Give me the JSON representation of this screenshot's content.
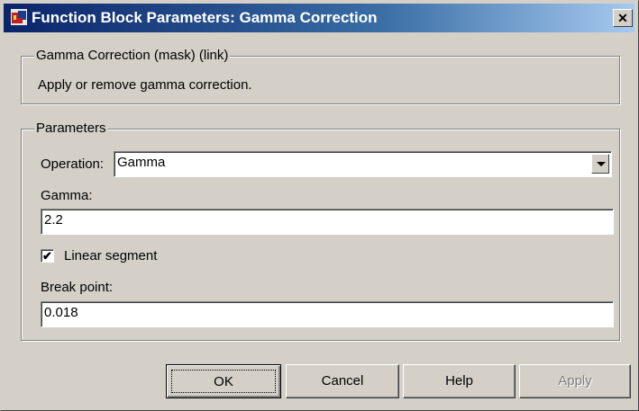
{
  "window": {
    "title": "Function Block Parameters: Gamma Correction",
    "close_label": "✕"
  },
  "description_group": {
    "legend": "Gamma Correction (mask) (link)",
    "text": "Apply or remove gamma correction."
  },
  "parameters_group": {
    "legend": "Parameters",
    "operation": {
      "label": "Operation:",
      "value": "Gamma"
    },
    "gamma": {
      "label": "Gamma:",
      "value": "2.2"
    },
    "linear_segment": {
      "label": "Linear segment",
      "checked": true,
      "mark": "✔"
    },
    "break_point": {
      "label": "Break point:",
      "value": "0.018"
    }
  },
  "buttons": {
    "ok": "OK",
    "cancel": "Cancel",
    "help": "Help",
    "apply": "Apply"
  }
}
